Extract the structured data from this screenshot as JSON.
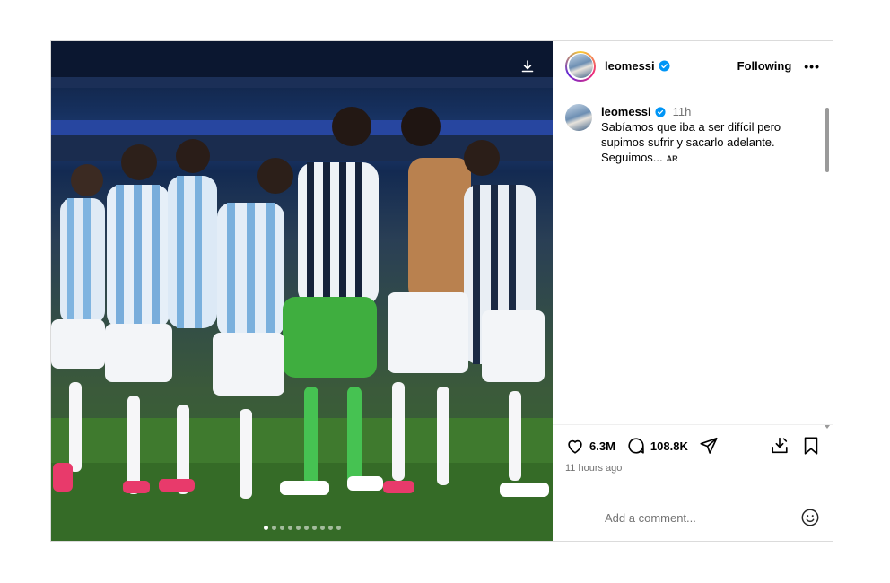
{
  "post": {
    "username": "leomessi",
    "follow_status": "Following",
    "more_label": "•••",
    "caption": {
      "username": "leomessi",
      "time": "11h",
      "text": "Sabíamos que iba a ser difícil pero\nsupimos sufrir y sacarlo adelante.\nSeguimos...",
      "translate_label": "AR"
    },
    "likes": "6.3M",
    "comments": "108.8K",
    "time_ago": "11 hours ago",
    "comment_placeholder": "Add a comment...",
    "carousel": {
      "count": 10,
      "active": 1
    }
  },
  "icons": {
    "download": "download-icon",
    "verified": "verified-badge-icon",
    "heart": "heart-icon",
    "comment": "comment-icon",
    "share": "share-icon",
    "save_download": "save-to-device-icon",
    "bookmark": "bookmark-icon",
    "emoji": "emoji-icon"
  },
  "colors": {
    "verified_blue": "#0095f6",
    "muted_text": "#737373",
    "border": "#dbdbdb"
  }
}
